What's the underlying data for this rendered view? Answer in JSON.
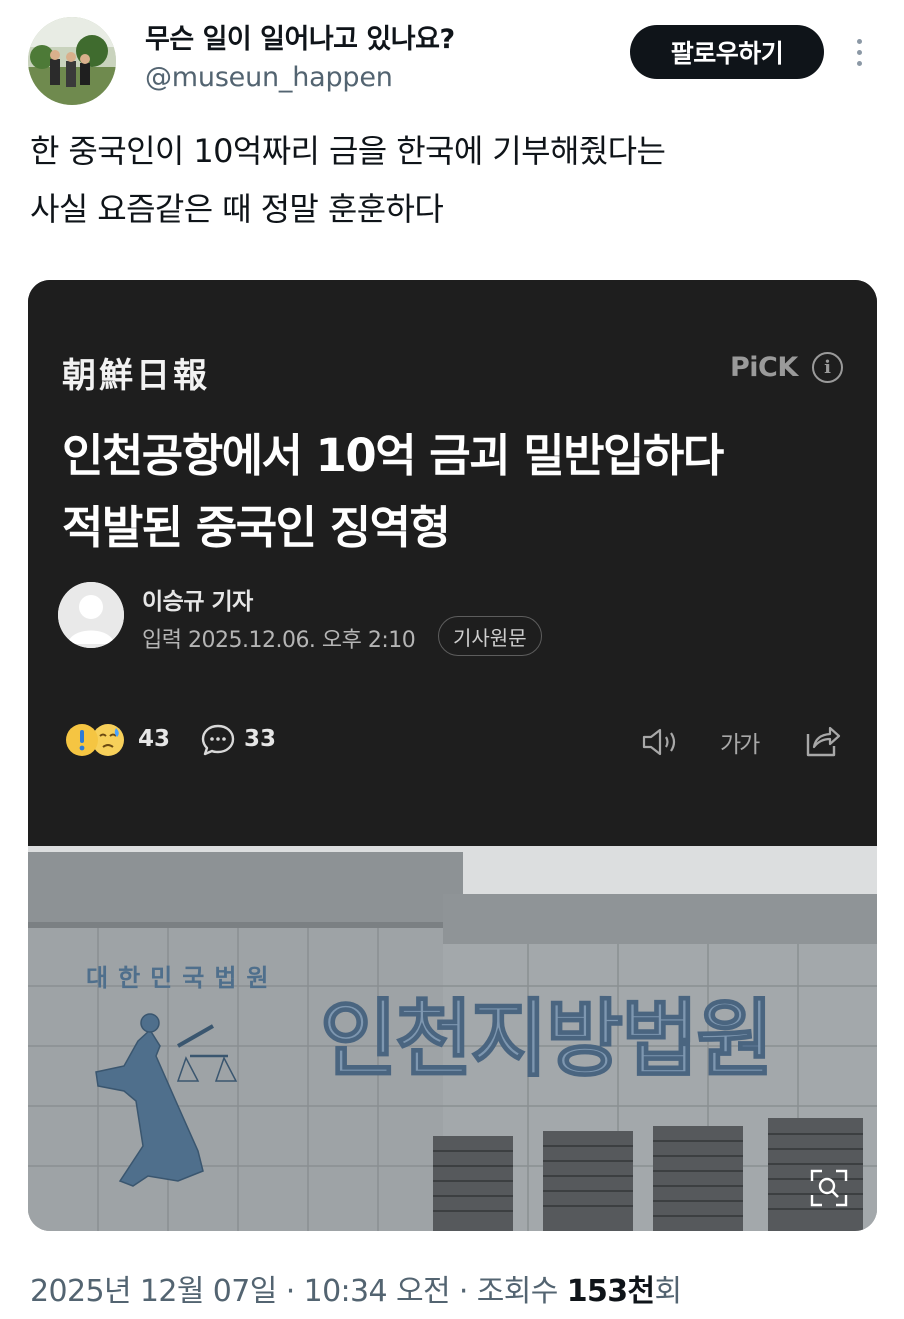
{
  "tweet": {
    "display_name": "무슨 일이 일어나고 있나요?",
    "handle": "@museun_happen",
    "follow_label": "팔로우하기",
    "more_icon": "more-vertical-icon",
    "text_lines": [
      "한 중국인이 10억짜리 금을 한국에 기부해줬다는",
      "사실 요즘같은 때 정말 훈훈하다"
    ],
    "timestamp": "2025년 12월 07일 · 10:34 오전 · 조회수",
    "views_number": "153천",
    "views_suffix": "회"
  },
  "article_card": {
    "publisher_logo": "朝鮮日報",
    "pick_label": "PiCK",
    "info_icon": "info-icon",
    "headline_lines": [
      "인천공항에서 10억 금괴 밀반입하다",
      "적발된 중국인 징역형"
    ],
    "author": "이승규 기자",
    "published_at": "입력 2025.12.06. 오후 2:10",
    "original_article_label": "기사원문",
    "reaction_count": "43",
    "comment_count": "33",
    "font_size_label": "가가",
    "photo_sign_text": "인천지방법원",
    "photo_emblem_text": "대한민국법원"
  },
  "colors": {
    "follow_bg": "#0f1419",
    "card_bg": "#1e1e1e",
    "secondary_text": "#536471"
  }
}
